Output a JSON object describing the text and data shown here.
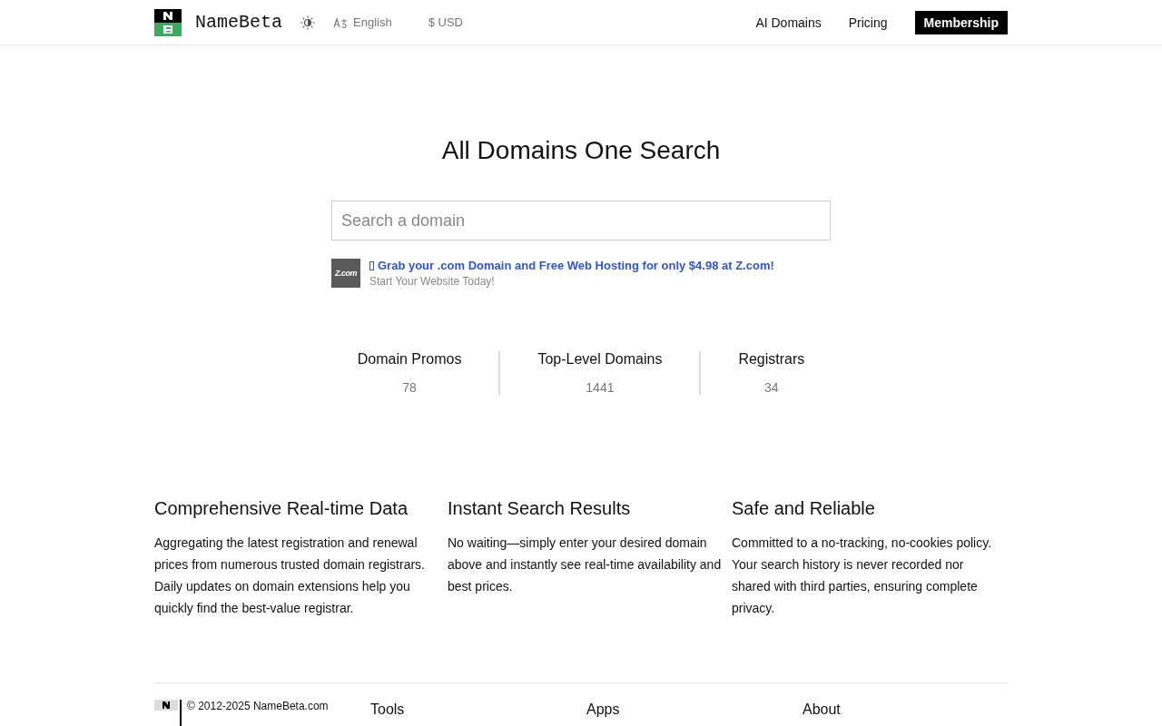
{
  "header": {
    "brand": "NameBeta",
    "language": "English",
    "currency": "$ USD",
    "nav": [
      {
        "label": "AI Domains",
        "kind": "link"
      },
      {
        "label": "Pricing",
        "kind": "link"
      },
      {
        "label": "Membership",
        "kind": "cta"
      }
    ]
  },
  "hero": {
    "title": "All Domains One Search",
    "search": {
      "placeholder": "Search a domain"
    },
    "ad": {
      "logo": "Z.com",
      "headline": "Grab your .com Domain and Free Web Hosting for only $4.98 at Z.com!",
      "subline": "Start Your Website Today!"
    }
  },
  "stats": [
    {
      "label": "Domain Promos",
      "value": "78"
    },
    {
      "label": "Top-Level Domains",
      "value": "1441"
    },
    {
      "label": "Registrars",
      "value": "34"
    }
  ],
  "features": [
    {
      "title": "Comprehensive Real-time Data",
      "text": "Aggregating the latest registration and renewal prices from numerous trusted domain registrars. Daily updates on domain extensions help you quickly find the best-value registrar."
    },
    {
      "title": "Instant Search Results",
      "text": "No waiting—simply enter your desired domain above and instantly see real-time availability and best prices."
    },
    {
      "title": "Safe and Reliable",
      "text": "Committed to a no-tracking, no-cookies policy. Your search history is never recorded nor shared with third parties, ensuring complete privacy."
    }
  ],
  "footer": {
    "copyright": "© 2012-2025 NameBeta.com",
    "columns": [
      "Tools",
      "Apps",
      "About"
    ]
  }
}
